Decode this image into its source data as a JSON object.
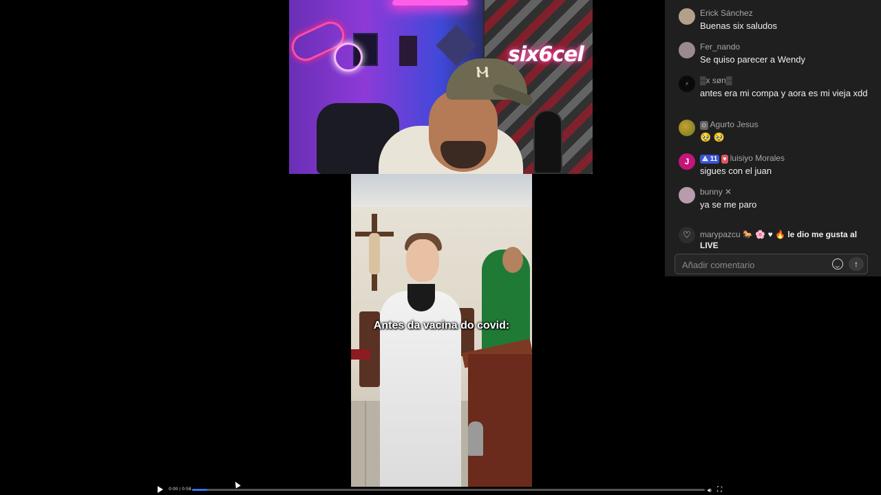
{
  "webcam": {
    "logo_text": "six6cel"
  },
  "video": {
    "caption": "Antes da vacina do covid:"
  },
  "player": {
    "time": "0:00 / 0:58",
    "progress": 0.03
  },
  "chat": {
    "messages": [
      {
        "user": "Erick Sánchez",
        "text": "Buenas six saludos"
      },
      {
        "user": "Fer_nando",
        "text": "Se quiso parecer a Wendy"
      },
      {
        "user": "▒x søn▒",
        "text": "antes era mi compa y aora es mi vieja xdd"
      },
      {
        "user": "Agurto Jesus",
        "text": "🥹 🥹"
      },
      {
        "user": "luisiyo Morales",
        "badge": "11",
        "avatar_initial": "J",
        "text": "sigues con el juan"
      },
      {
        "user": "bunny ✕",
        "text": "ya se me paro"
      }
    ],
    "like_event": {
      "user": "marypazcu",
      "action": "le dio me gusta al LIVE"
    },
    "comment": {
      "placeholder": "Añadir comentario",
      "value": ""
    }
  }
}
